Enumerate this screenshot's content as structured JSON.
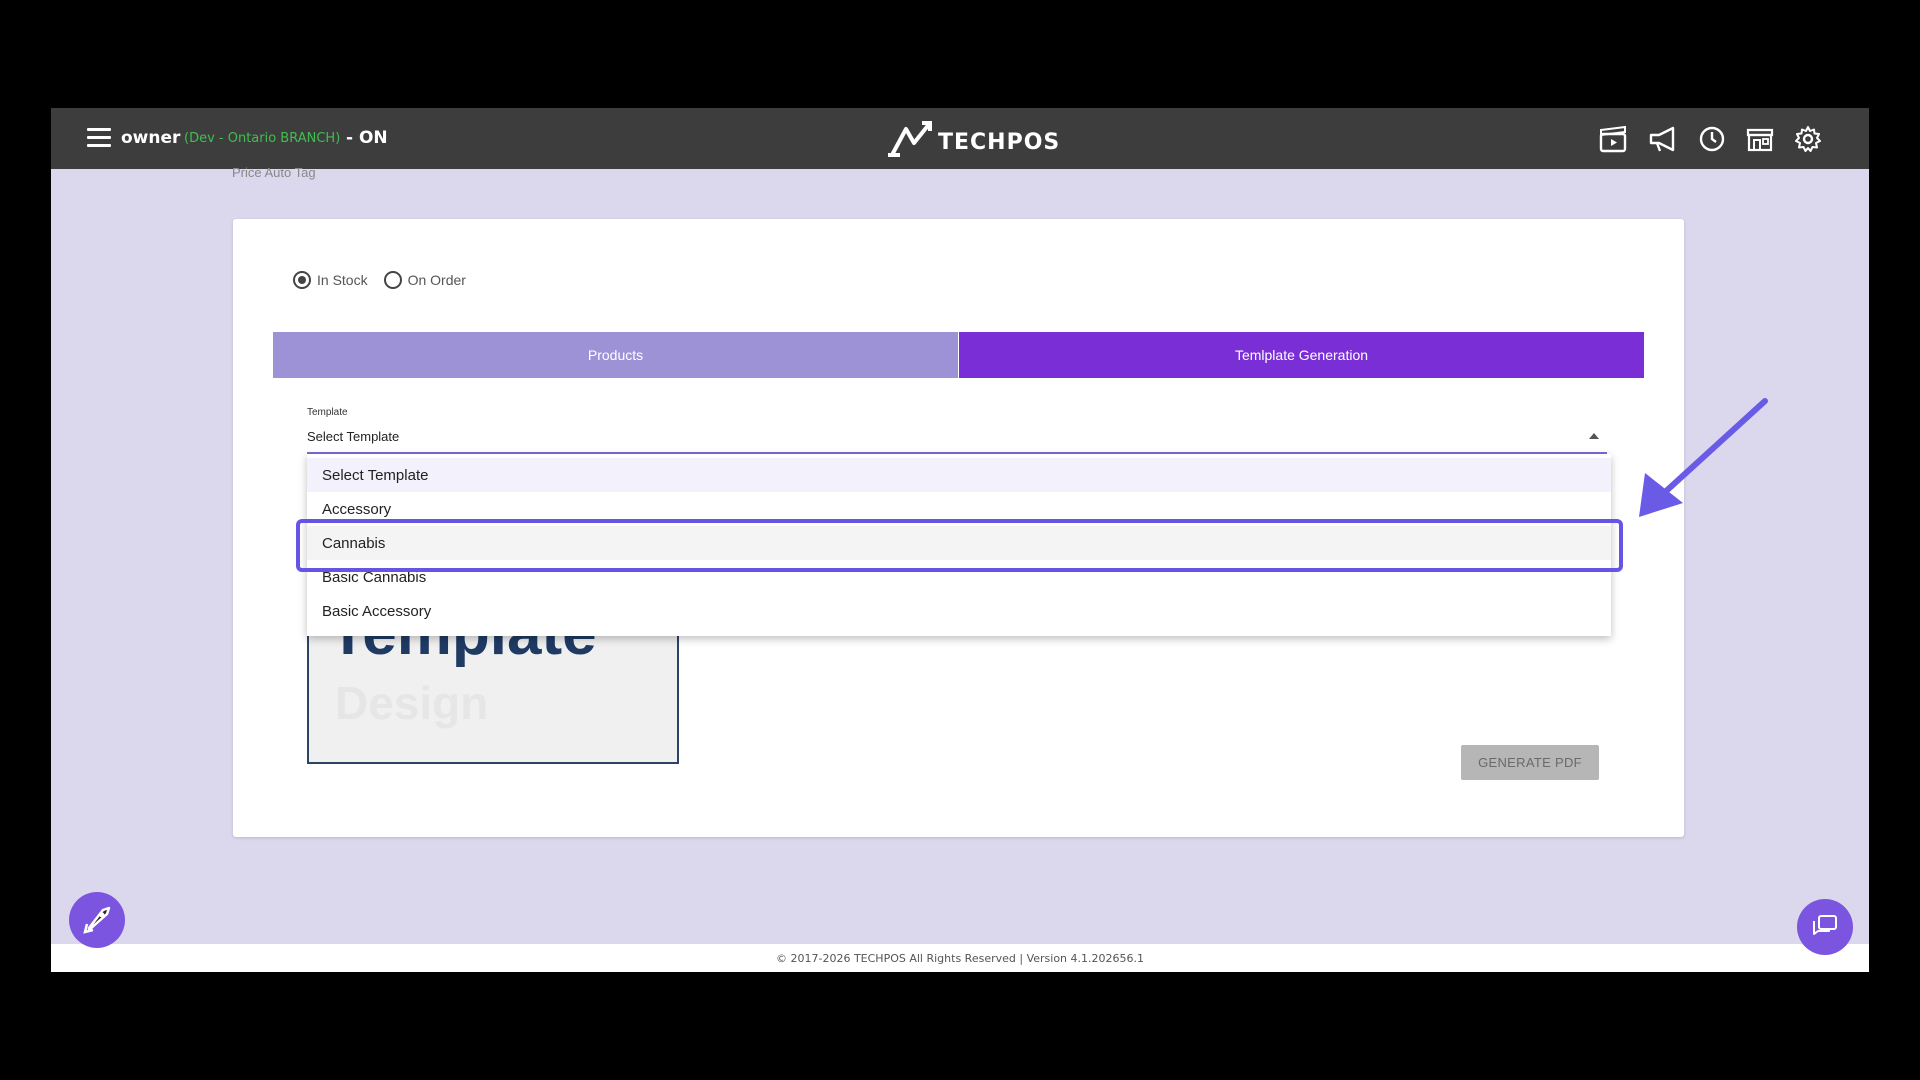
{
  "header": {
    "user": "owner",
    "branch": "(Dev - Ontario BRANCH)",
    "status": "- ON",
    "logo_text": "TECHPOS",
    "icons": [
      "clapperboard-icon",
      "megaphone-icon",
      "clock-icon",
      "store-icon",
      "gear-icon"
    ]
  },
  "breadcrumb": "Price Auto Tag",
  "stock_options": {
    "in_stock": "In Stock",
    "on_order": "On Order",
    "selected": "In Stock"
  },
  "tabs": [
    {
      "label": "Products",
      "active": false
    },
    {
      "label": "Temlplate Generation",
      "active": true
    }
  ],
  "template": {
    "label": "Template",
    "value": "Select Template",
    "options": [
      "Select Template",
      "Accessory",
      "Cannabis",
      "Basic Cannabis",
      "Basic Accessory"
    ],
    "highlighted": "Cannabis"
  },
  "preview": {
    "text": "Template",
    "sub": "Design"
  },
  "generate_button": "GENERATE PDF",
  "footer": "© 2017-2026 TECHPOS All Rights Reserved | Version 4.1.202656.1",
  "colors": {
    "header_bg": "#3d3d3d",
    "page_bg": "#dbd8ee",
    "tab_active": "#7a2fd6",
    "tab_inactive": "#9e92d6",
    "highlight": "#6654e8",
    "branch_green": "#3fbf4f"
  }
}
